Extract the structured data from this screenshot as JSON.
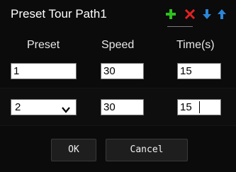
{
  "dialog": {
    "title": "Preset Tour Path1",
    "toolbar_icons": {
      "add": {
        "icon": "plus-icon",
        "color": "#2ec01e"
      },
      "delete": {
        "icon": "x-icon",
        "color": "#e02222"
      },
      "move_down": {
        "icon": "arrow-down-icon",
        "color": "#2c86d8"
      },
      "move_up": {
        "icon": "arrow-up-icon",
        "color": "#2c86d8"
      }
    }
  },
  "columns": {
    "preset": "Preset",
    "speed": "Speed",
    "time": "Time(s)"
  },
  "rows": [
    {
      "preset": "1",
      "speed": "30",
      "time": "15"
    },
    {
      "preset": "2",
      "speed": "30",
      "time": "15"
    }
  ],
  "buttons": {
    "ok": "OK",
    "cancel": "Cancel"
  }
}
